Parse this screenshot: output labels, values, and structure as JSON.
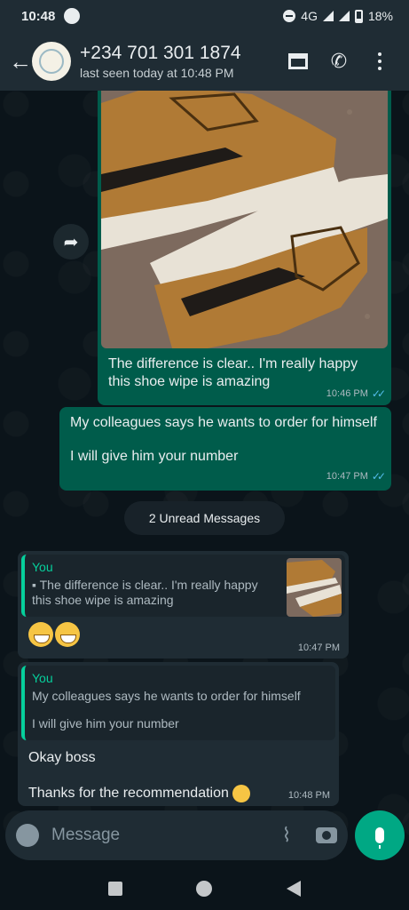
{
  "status_bar": {
    "time": "10:48",
    "network": "4G",
    "battery": "18%"
  },
  "header": {
    "contact_name": "+234 701 301 1874",
    "last_seen": "last seen today at 10:48 PM"
  },
  "messages": {
    "image_message": {
      "caption": "The difference is clear.. I'm really happy this shoe wipe is amazing",
      "time": "10:46 PM"
    },
    "text_message": {
      "line1": "My colleagues says he wants to order for himself",
      "line2": "I will give him your number",
      "time": "10:47 PM"
    },
    "unread_divider": "2 Unread Messages",
    "reply1": {
      "quote_author": "You",
      "quote_text": "The difference is clear.. I'm really happy this shoe wipe is amazing",
      "time": "10:47 PM"
    },
    "reply2": {
      "quote_author": "You",
      "quote_line1": "My colleagues says he wants to order for himself",
      "quote_line2": "I will give him your number",
      "text1": "Okay boss",
      "text2": "Thanks for the recommendation",
      "time": "10:48 PM"
    }
  },
  "input": {
    "placeholder": "Message"
  },
  "colors": {
    "accent": "#00a884",
    "outgoing_bubble": "#005c4b",
    "incoming_bubble": "#1f2c34",
    "read_ticks": "#53bdeb",
    "quote_bar": "#06cf9c"
  },
  "icons": [
    "back-arrow-icon",
    "shop-icon",
    "add-call-icon",
    "more-options-icon",
    "forward-icon",
    "emoji-icon",
    "attach-icon",
    "camera-icon",
    "mic-icon"
  ]
}
